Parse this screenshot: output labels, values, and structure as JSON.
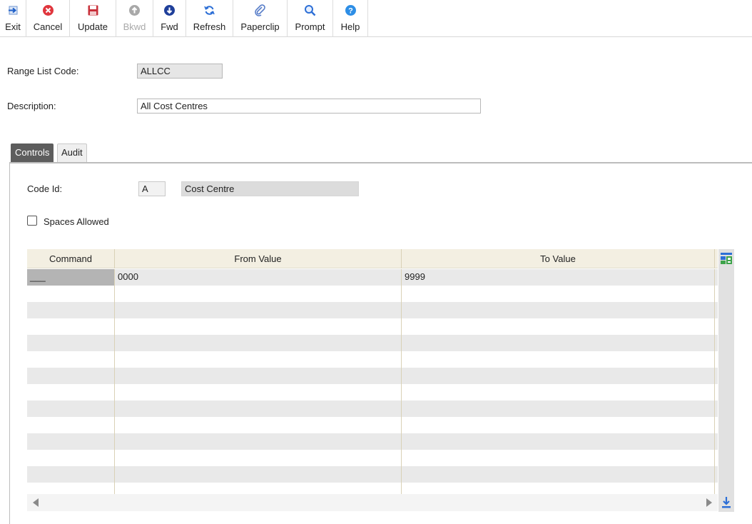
{
  "toolbar": {
    "buttons": [
      {
        "label": "Exit",
        "icon": "exit-arrow-icon",
        "enabled": true
      },
      {
        "label": "Cancel",
        "icon": "cancel-x-icon",
        "enabled": true
      },
      {
        "label": "Update",
        "icon": "save-disk-icon",
        "enabled": true
      },
      {
        "label": "Bkwd",
        "icon": "arrow-up-icon",
        "enabled": false
      },
      {
        "label": "Fwd",
        "icon": "arrow-down-icon",
        "enabled": true
      },
      {
        "label": "Refresh",
        "icon": "refresh-icon",
        "enabled": true
      },
      {
        "label": "Paperclip",
        "icon": "paperclip-icon",
        "enabled": true
      },
      {
        "label": "Prompt",
        "icon": "magnifier-icon",
        "enabled": true
      },
      {
        "label": "Help",
        "icon": "help-icon",
        "enabled": true
      }
    ]
  },
  "form": {
    "range_list_code_label": "Range List Code:",
    "range_list_code_value": "ALLCC",
    "description_label": "Description:",
    "description_value": "All Cost Centres"
  },
  "tabs": [
    {
      "label": "Controls",
      "active": true
    },
    {
      "label": "Audit",
      "active": false
    }
  ],
  "controls": {
    "code_id_label": "Code Id:",
    "code_id_value": "A",
    "code_id_desc": "Cost Centre",
    "spaces_allowed_label": "Spaces Allowed",
    "spaces_allowed_checked": false
  },
  "grid": {
    "columns": [
      "Command",
      "From Value",
      "To Value"
    ],
    "rows": [
      [
        "___",
        "0000",
        "9999"
      ],
      [
        "",
        "",
        ""
      ],
      [
        "",
        "",
        ""
      ],
      [
        "",
        "",
        ""
      ],
      [
        "",
        "",
        ""
      ],
      [
        "",
        "",
        ""
      ],
      [
        "",
        "",
        ""
      ],
      [
        "",
        "",
        ""
      ],
      [
        "",
        "",
        ""
      ],
      [
        "",
        "",
        ""
      ],
      [
        "",
        "",
        ""
      ],
      [
        "",
        "",
        ""
      ],
      [
        "",
        "",
        ""
      ],
      [
        "",
        "",
        ""
      ]
    ]
  },
  "colors": {
    "accent_blue": "#2d6fd6",
    "cancel_red": "#e0363d",
    "update_red": "#c8303a",
    "tab_active": "#5d5d5d",
    "grid_header": "#f3efe2"
  }
}
